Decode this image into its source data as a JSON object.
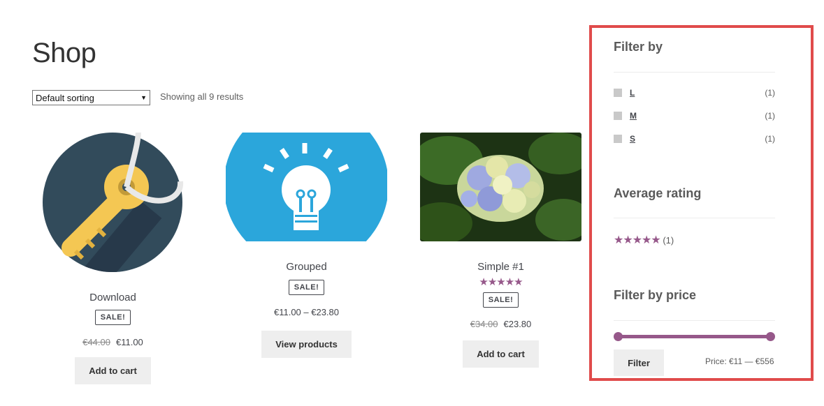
{
  "shop": {
    "title": "Shop",
    "sorting": "Default sorting",
    "result_count": "Showing all 9 results"
  },
  "products": [
    {
      "name": "Download",
      "badge": "SALE!",
      "price_old": "€44.00",
      "price_new": "€11.00",
      "button": "Add to cart",
      "image": "key-icon"
    },
    {
      "name": "Grouped",
      "badge": "SALE!",
      "price_range": "€11.00 – €23.80",
      "button": "View products",
      "image": "lightbulb-icon"
    },
    {
      "name": "Simple #1",
      "rating": 5,
      "stars": "★★★★★",
      "badge": "SALE!",
      "price_old": "€34.00",
      "price_new": "€23.80",
      "button": "Add to cart",
      "image": "hydrangea-photo"
    }
  ],
  "sidebar": {
    "filter_by": {
      "title": "Filter by",
      "options": [
        {
          "label": "L",
          "count": "(1)"
        },
        {
          "label": "M",
          "count": "(1)"
        },
        {
          "label": "S",
          "count": "(1)"
        }
      ]
    },
    "average_rating": {
      "title": "Average rating",
      "stars": "★★★★★",
      "rating": 5,
      "count": "(1)"
    },
    "filter_by_price": {
      "title": "Filter by price",
      "button": "Filter",
      "price_label": "Price: €11 — €556",
      "min": 11,
      "max": 556
    }
  },
  "colors": {
    "accent": "#96588a",
    "highlight_border": "#e04b4b",
    "button_bg": "#eeeeee"
  }
}
